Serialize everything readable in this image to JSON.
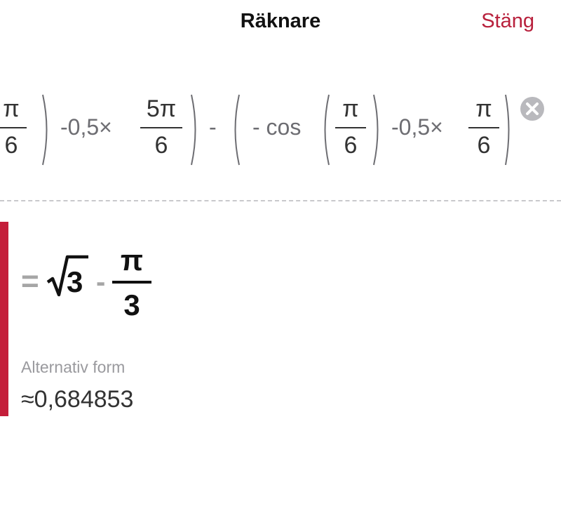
{
  "header": {
    "title": "Räknare",
    "close_label": "Stäng"
  },
  "expression": {
    "frac1": {
      "num": "π",
      "den": "6"
    },
    "term1": "-0,5×",
    "frac2": {
      "num": "5π",
      "den": "6"
    },
    "minus": "-",
    "neg_cos": "- cos",
    "frac3": {
      "num": "π",
      "den": "6"
    },
    "term2": "-0,5×",
    "frac4": {
      "num": "π",
      "den": "6"
    }
  },
  "result": {
    "equals": "=",
    "radicand": "3",
    "minus": "-",
    "frac_num": "π",
    "frac_den": "3",
    "alt_label": "Alternativ form",
    "approx_value": "≈0,684853"
  },
  "colors": {
    "accent": "#c41e3a",
    "close_text": "#b8203c"
  }
}
